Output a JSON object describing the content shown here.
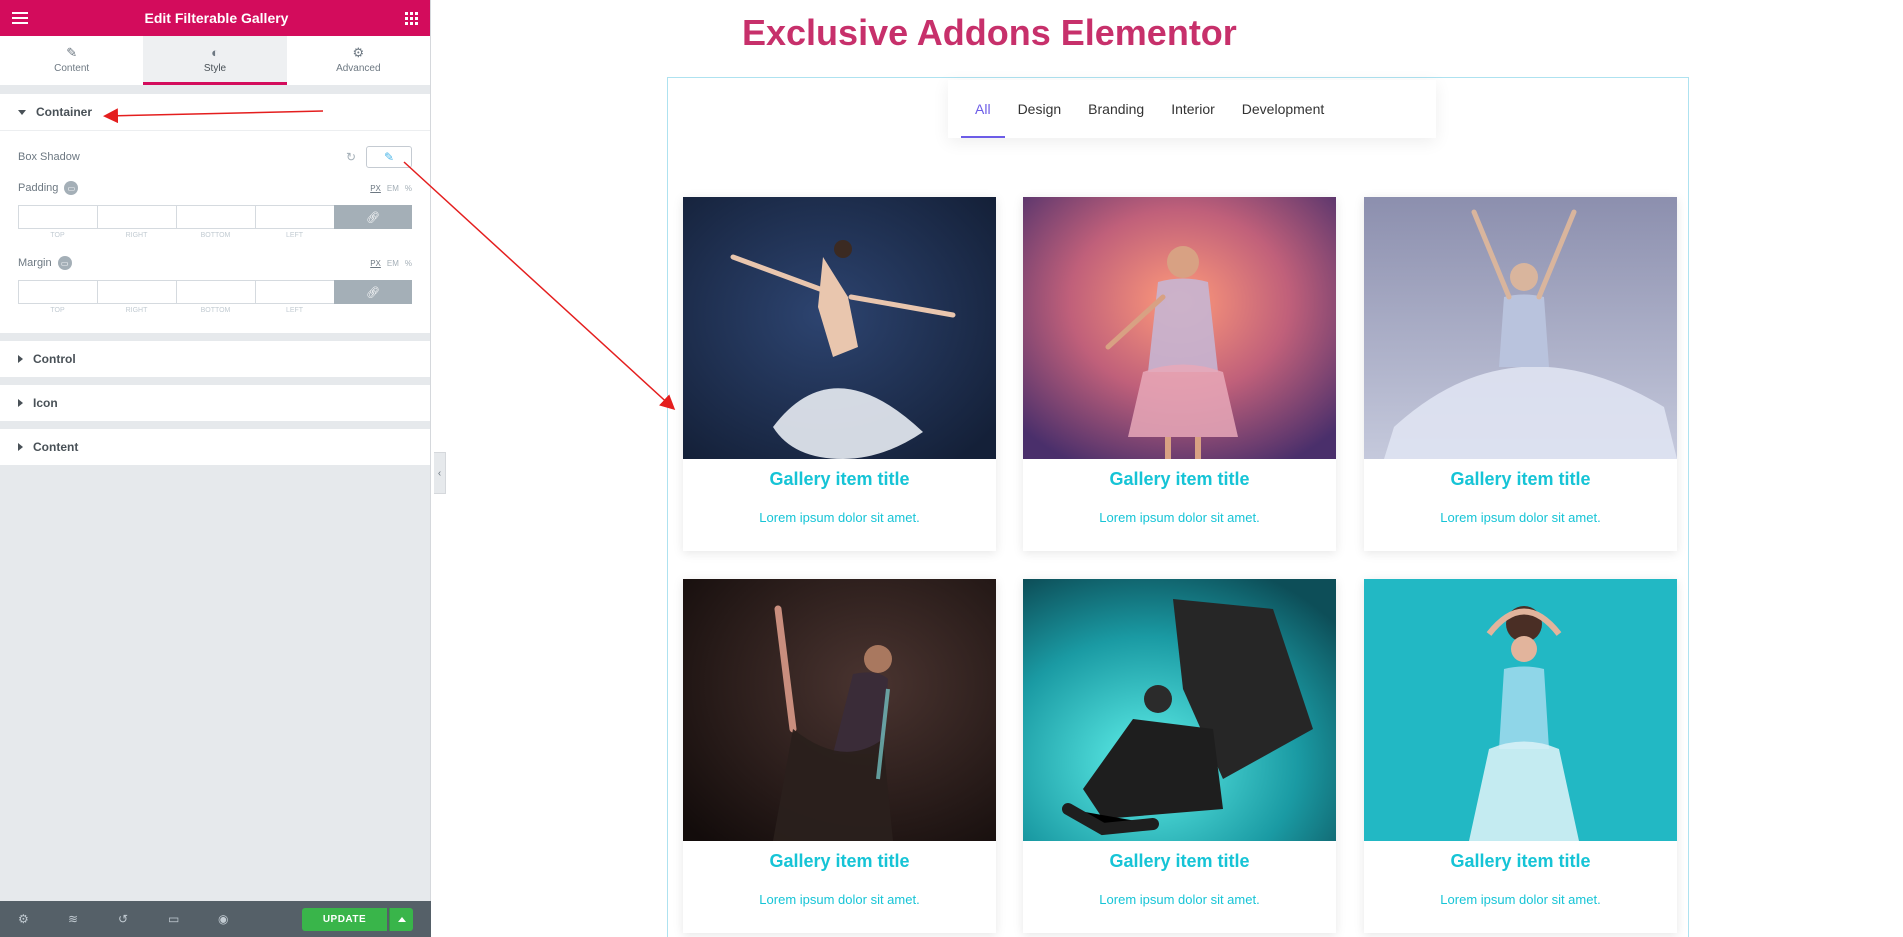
{
  "editor": {
    "title": "Edit Filterable Gallery",
    "tabs": [
      {
        "label": "Content",
        "icon": "pencil-icon"
      },
      {
        "label": "Style",
        "icon": "contrast-icon"
      },
      {
        "label": "Advanced",
        "icon": "gear-icon"
      }
    ],
    "active_tab": "Style",
    "container": {
      "label": "Container",
      "box_shadow_label": "Box Shadow",
      "padding_label": "Padding",
      "margin_label": "Margin",
      "units": [
        "PX",
        "EM",
        "%"
      ],
      "dim_labels": [
        "TOP",
        "RIGHT",
        "BOTTOM",
        "LEFT"
      ]
    },
    "sections": [
      "Control",
      "Icon",
      "Content"
    ],
    "footer": {
      "icons": [
        "settings-icon",
        "layers-icon",
        "history-icon",
        "responsive-icon",
        "preview-icon"
      ],
      "update_label": "UPDATE"
    }
  },
  "page": {
    "title": "Exclusive Addons Elementor",
    "filters": [
      "All",
      "Design",
      "Branding",
      "Interior",
      "Development"
    ],
    "active_filter": "All",
    "items": [
      {
        "title": "Gallery item title",
        "desc": "Lorem ipsum dolor sit amet.",
        "bg": "#1b2a4a"
      },
      {
        "title": "Gallery item title",
        "desc": "Lorem ipsum dolor sit amet.",
        "bg": "#e08a6a"
      },
      {
        "title": "Gallery item title",
        "desc": "Lorem ipsum dolor sit amet.",
        "bg": "#9aa0bd"
      },
      {
        "title": "Gallery item title",
        "desc": "Lorem ipsum dolor sit amet.",
        "bg": "#2a1e1a"
      },
      {
        "title": "Gallery item title",
        "desc": "Lorem ipsum dolor sit amet.",
        "bg": "#24c9c9"
      },
      {
        "title": "Gallery item title",
        "desc": "Lorem ipsum dolor sit amet.",
        "bg": "#22b8c4"
      }
    ]
  },
  "colors": {
    "brand": "#d30c5c",
    "title": "#c7306b",
    "accent_text": "#16c4d6",
    "filter_active": "#6c5ce7",
    "update": "#39b54a"
  }
}
